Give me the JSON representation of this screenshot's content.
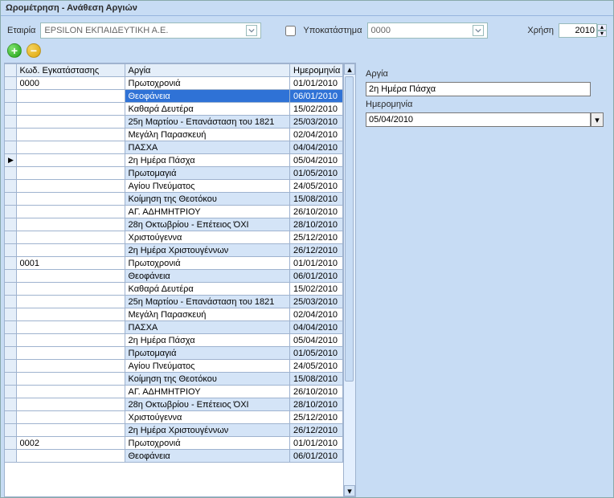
{
  "window": {
    "title": "Ωρομέτρηση - Ανάθεση Αργιών"
  },
  "toolbar": {
    "company_label": "Εταιρία",
    "company_value": "EPSILON ΕΚΠΑΙΔΕΥΤΙΚΗ Α.Ε.",
    "branch_checkbox_label": "Υποκατάστημα",
    "branch_value": "0000",
    "year_label": "Χρήση",
    "year_value": "2010"
  },
  "grid": {
    "headers": {
      "code": "Κωδ. Εγκατάστασης",
      "holiday": "Αργία",
      "date": "Ημερομηνία"
    },
    "rows": [
      {
        "code": "0000",
        "name": "Πρωτοχρονιά",
        "date": "01/01/2010",
        "marker": ""
      },
      {
        "code": "",
        "name": "Θεοφάνεια",
        "date": "06/01/2010",
        "marker": "",
        "selected": true
      },
      {
        "code": "",
        "name": "Καθαρά Δευτέρα",
        "date": "15/02/2010",
        "marker": ""
      },
      {
        "code": "",
        "name": "25η Μαρτίου - Επανάσταση του 1821",
        "date": "25/03/2010",
        "marker": ""
      },
      {
        "code": "",
        "name": "Μεγάλη Παρασκευή",
        "date": "02/04/2010",
        "marker": ""
      },
      {
        "code": "",
        "name": "ΠΑΣΧΑ",
        "date": "04/04/2010",
        "marker": ""
      },
      {
        "code": "",
        "name": "2η Ημέρα Πάσχα",
        "date": "05/04/2010",
        "marker": "▶"
      },
      {
        "code": "",
        "name": "Πρωτομαγιά",
        "date": "01/05/2010",
        "marker": ""
      },
      {
        "code": "",
        "name": "Αγίου Πνεύματος",
        "date": "24/05/2010",
        "marker": ""
      },
      {
        "code": "",
        "name": "Κοίμηση της Θεοτόκου",
        "date": "15/08/2010",
        "marker": ""
      },
      {
        "code": "",
        "name": "ΑΓ. ΑΔΗΜΗΤΡΙΟΥ",
        "date": "26/10/2010",
        "marker": ""
      },
      {
        "code": "",
        "name": "28η Οκτωβρίου - Επέτειος ΌΧΙ",
        "date": "28/10/2010",
        "marker": ""
      },
      {
        "code": "",
        "name": "Χριστούγεννα",
        "date": "25/12/2010",
        "marker": ""
      },
      {
        "code": "",
        "name": "2η Ημέρα Χριστουγέννων",
        "date": "26/12/2010",
        "marker": ""
      },
      {
        "code": "0001",
        "name": "Πρωτοχρονιά",
        "date": "01/01/2010",
        "marker": ""
      },
      {
        "code": "",
        "name": "Θεοφάνεια",
        "date": "06/01/2010",
        "marker": ""
      },
      {
        "code": "",
        "name": "Καθαρά Δευτέρα",
        "date": "15/02/2010",
        "marker": ""
      },
      {
        "code": "",
        "name": "25η Μαρτίου - Επανάσταση του 1821",
        "date": "25/03/2010",
        "marker": ""
      },
      {
        "code": "",
        "name": "Μεγάλη Παρασκευή",
        "date": "02/04/2010",
        "marker": ""
      },
      {
        "code": "",
        "name": "ΠΑΣΧΑ",
        "date": "04/04/2010",
        "marker": ""
      },
      {
        "code": "",
        "name": "2η Ημέρα Πάσχα",
        "date": "05/04/2010",
        "marker": ""
      },
      {
        "code": "",
        "name": "Πρωτομαγιά",
        "date": "01/05/2010",
        "marker": ""
      },
      {
        "code": "",
        "name": "Αγίου Πνεύματος",
        "date": "24/05/2010",
        "marker": ""
      },
      {
        "code": "",
        "name": "Κοίμηση της Θεοτόκου",
        "date": "15/08/2010",
        "marker": ""
      },
      {
        "code": "",
        "name": "ΑΓ. ΑΔΗΜΗΤΡΙΟΥ",
        "date": "26/10/2010",
        "marker": ""
      },
      {
        "code": "",
        "name": "28η Οκτωβρίου - Επέτειος ΌΧΙ",
        "date": "28/10/2010",
        "marker": ""
      },
      {
        "code": "",
        "name": "Χριστούγεννα",
        "date": "25/12/2010",
        "marker": ""
      },
      {
        "code": "",
        "name": "2η Ημέρα Χριστουγέννων",
        "date": "26/12/2010",
        "marker": ""
      },
      {
        "code": "0002",
        "name": "Πρωτοχρονιά",
        "date": "01/01/2010",
        "marker": ""
      },
      {
        "code": "",
        "name": "Θεοφάνεια",
        "date": "06/01/2010",
        "marker": ""
      }
    ]
  },
  "detail": {
    "holiday_label": "Αργία",
    "holiday_value": "2η Ημέρα Πάσχα",
    "date_label": "Ημερομηνία",
    "date_value": "05/04/2010"
  }
}
